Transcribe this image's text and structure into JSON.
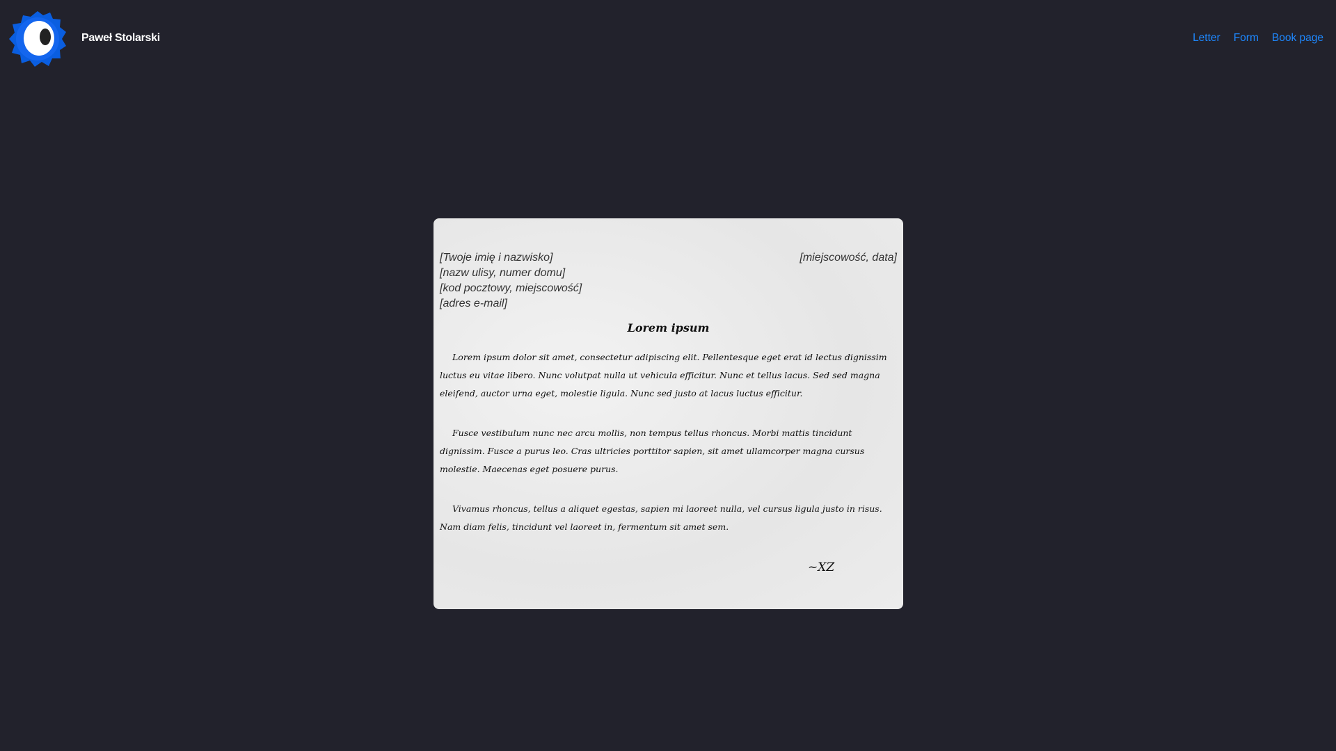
{
  "header": {
    "brand": "Paweł Stolarski",
    "nav": [
      "Letter",
      "Form",
      "Book page"
    ],
    "accent": "#1e88ff"
  },
  "letter": {
    "sender": [
      "[Twoje imię i nazwisko]",
      "[nazw ulisy, numer domu]",
      "[kod pocztowy, miejscowość]",
      "[adres e-mail]"
    ],
    "place_date": "[miejscowość, data]",
    "title": "Lorem ipsum",
    "paragraphs": [
      "Lorem ipsum dolor sit amet, consectetur adipiscing elit. Pellentesque eget erat id lectus dignissim luctus eu vitae libero. Nunc volutpat nulla ut vehicula efficitur. Nunc et tellus lacus. Sed sed magna eleifend, auctor urna eget, molestie ligula. Nunc sed justo at lacus luctus efficitur.",
      "Fusce vestibulum nunc nec arcu mollis, non tempus tellus rhoncus. Morbi mattis tincidunt dignissim. Fusce a purus leo. Cras ultricies porttitor sapien, sit amet ullamcorper magna cursus molestie. Maecenas eget posuere purus.",
      "Vivamus rhoncus, tellus a aliquet egestas, sapien mi laoreet nulla, vel cursus ligula justo in risus. Nam diam felis, tincidunt vel laoreet in, fermentum sit amet sem."
    ],
    "signature": "~XZ"
  }
}
